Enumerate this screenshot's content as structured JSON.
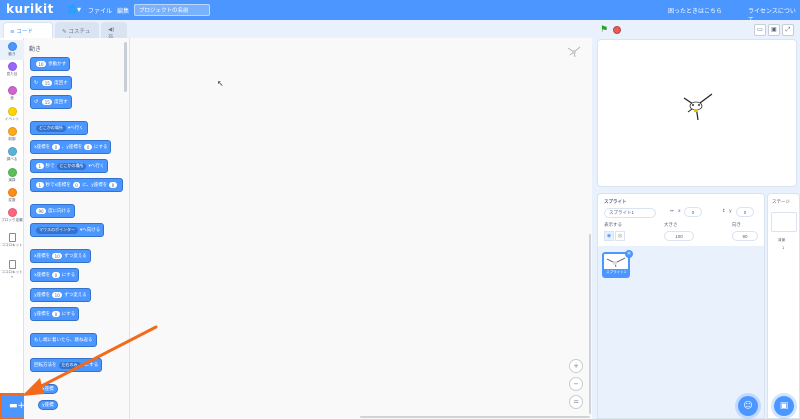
{
  "app": {
    "logo": "kurikit",
    "globe_icon": "globe-icon"
  },
  "menu": {
    "file": "ファイル",
    "edit": "編集",
    "project_title": "プロジェクトの名前",
    "help": "困ったときはこちら",
    "license": "ライセンスについて"
  },
  "tabs": {
    "code": "コード",
    "costume": "コスチューム",
    "sound": "音"
  },
  "categories": [
    {
      "label": "動き",
      "color": "#4c97ff"
    },
    {
      "label": "見た目",
      "color": "#9966ff"
    },
    {
      "label": "音",
      "color": "#cf63cf"
    },
    {
      "label": "イベント",
      "color": "#ffd500"
    },
    {
      "label": "制御",
      "color": "#ffab19"
    },
    {
      "label": "調べる",
      "color": "#5cb1d6"
    },
    {
      "label": "演算",
      "color": "#59c059"
    },
    {
      "label": "変数",
      "color": "#ff8c1a"
    },
    {
      "label": "ブロック定義",
      "color": "#ff6680"
    },
    {
      "label": "ココロキット",
      "color": ""
    },
    {
      "label": "ココロキット+",
      "color": ""
    }
  ],
  "palette": {
    "heading": "動き",
    "blocks": {
      "move": {
        "pre": "",
        "val": "10",
        "post": "歩動かす"
      },
      "turn_right": {
        "val": "15",
        "post": "度回す"
      },
      "turn_left": {
        "val": "15",
        "post": "度回す"
      },
      "goto": {
        "drop": "どこかの場所",
        "post": "へ行く"
      },
      "goto_xy": {
        "a": "x座標を",
        "x": "0",
        "b": "、y座標を",
        "y": "0",
        "c": "にする"
      },
      "glide": {
        "val": "1",
        "a": "秒で",
        "drop": "どこかの場所",
        "b": "へ行く"
      },
      "glide_xy": {
        "val": "1",
        "a": "秒でx座標を",
        "x": "0",
        "b": "に、y座標を",
        "y": "0"
      },
      "point_dir": {
        "val": "90",
        "post": "度に向ける"
      },
      "point_towards": {
        "drop": "マウスのポインター",
        "post": "へ向ける"
      },
      "change_x": {
        "a": "x座標を",
        "val": "10",
        "b": "ずつ変える"
      },
      "set_x": {
        "a": "x座標を",
        "val": "0",
        "b": "にする"
      },
      "change_y": {
        "a": "y座標を",
        "val": "10",
        "b": "ずつ変える"
      },
      "set_y": {
        "a": "y座標を",
        "val": "0",
        "b": "にする"
      },
      "bounce": {
        "label": "もし端に着いたら、跳ね返る"
      },
      "rotation_style": {
        "a": "回転方法を",
        "drop": "左右のみ",
        "b": "にする"
      },
      "x_reporter": {
        "label": "x座標"
      },
      "y_reporter": {
        "label": "y座標"
      }
    }
  },
  "stage_controls": {
    "flag_icon": "green-flag-icon",
    "stop_icon": "stop-icon"
  },
  "sprite_info": {
    "sprite_label": "スプライト",
    "sprite_name": "スプライト1",
    "x_label": "x",
    "x_value": "0",
    "y_label": "y",
    "y_value": "0",
    "show_label": "表示する",
    "size_label": "大きさ",
    "size_value": "100",
    "direction_label": "向き",
    "direction_value": "90"
  },
  "sprite_list": [
    {
      "name": "スプライト1"
    }
  ],
  "stage_pane": {
    "title": "ステージ",
    "backdrop_label": "背景",
    "backdrop_count": "1"
  },
  "colors": {
    "accent": "#4c97ff",
    "highlight": "#f26a1b"
  }
}
